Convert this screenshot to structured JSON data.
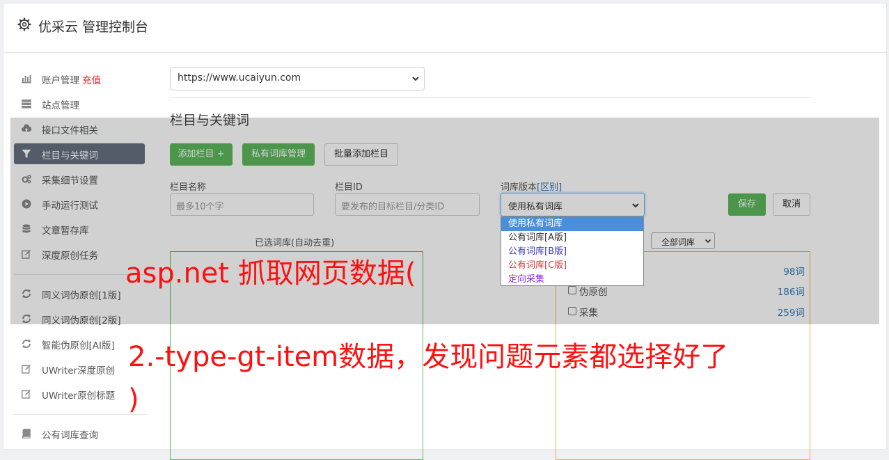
{
  "header": {
    "title": "优采云 管理控制台"
  },
  "sidebar": {
    "items": [
      {
        "label": "账户管理",
        "extra": "充值",
        "icon": "bar-chart-icon"
      },
      {
        "label": "站点管理",
        "icon": "server-icon"
      },
      {
        "label": "接口文件相关",
        "icon": "cloud-upload-icon"
      },
      {
        "label": "栏目与关键词",
        "icon": "filter-icon",
        "active": true
      },
      {
        "label": "采集细节设置",
        "icon": "gears-icon"
      },
      {
        "label": "手动运行测试",
        "icon": "play-circle-icon"
      },
      {
        "label": "文章暂存库",
        "icon": "database-icon"
      },
      {
        "label": "深度原创任务",
        "icon": "edit-icon"
      },
      {
        "label": "同义词伪原创[1版]",
        "icon": "refresh-icon"
      },
      {
        "label": "同义词伪原创[2版]",
        "icon": "refresh-icon"
      },
      {
        "label": "智能伪原创[AI版]",
        "icon": "refresh-icon"
      },
      {
        "label": "UWriter深度原创",
        "icon": "edit-icon"
      },
      {
        "label": "UWriter原创标题",
        "icon": "edit-icon"
      },
      {
        "label": "公有词库查询",
        "icon": "book-icon"
      }
    ]
  },
  "main": {
    "site_select": "https://www.ucaiyun.com",
    "section_title": "栏目与关键词",
    "buttons": {
      "add_column": "添加栏目 +",
      "private_lib": "私有词库管理",
      "batch_add": "批量添加栏目",
      "save": "保存",
      "cancel": "取消"
    },
    "form": {
      "name_label": "栏目名称",
      "name_placeholder": "最多10个字",
      "id_label": "栏目ID",
      "id_placeholder": "要发布的目标栏目/分类ID",
      "version_label": "词库版本",
      "version_link": "[区别]",
      "version_value": "使用私有词库"
    },
    "dropdown": {
      "options": [
        {
          "label": "使用私有词库",
          "color": "#ffffff",
          "selected": true
        },
        {
          "label": "公有词库[A版]",
          "color": "#333333"
        },
        {
          "label": "公有词库[B版]",
          "color": "#3a3ad0"
        },
        {
          "label": "公有词库[C版]",
          "color": "#d04040"
        },
        {
          "label": "定向采集",
          "color": "#8a2be2"
        }
      ]
    },
    "selected_caption": "已选词库(自动去重)",
    "all_libs": "全部词库",
    "lib_rows": [
      {
        "name": "",
        "count": "98词"
      },
      {
        "name": "伪原创",
        "count": "186词"
      },
      {
        "name": "采集",
        "count": "259词"
      }
    ]
  },
  "overlay_text": {
    "line1": "asp.net 抓取网页数据(",
    "line2": "2.-type-gt-item数据，发现问题元素都选择好了",
    "line3": ")"
  },
  "colors": {
    "accent_green": "#5cb85c",
    "sidebar_active": "#667180",
    "overlay_red": "#ff1010",
    "link_blue": "#337ab7"
  }
}
